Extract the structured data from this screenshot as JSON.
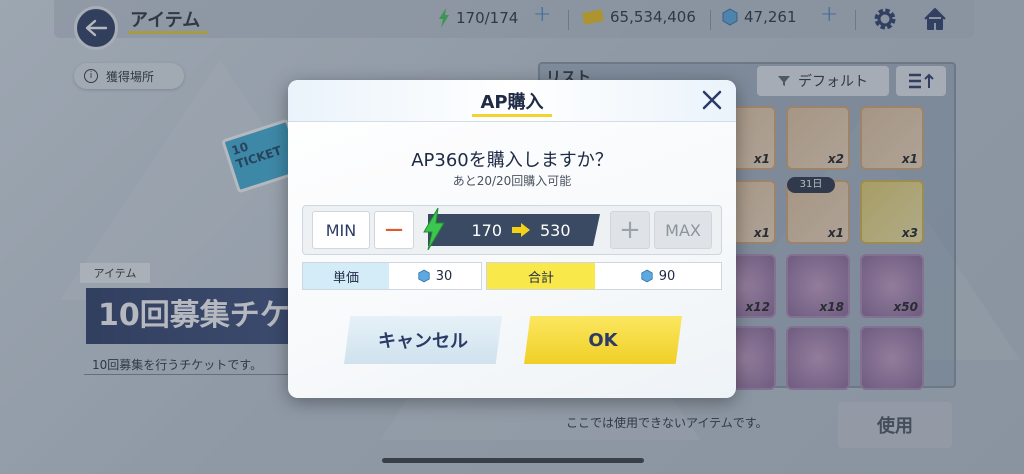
{
  "header": {
    "title": "アイテム",
    "ap": "170/174",
    "gold": "65,534,406",
    "gems": "47,261"
  },
  "left_panel": {
    "acquisition_label": "獲得場所",
    "category_tag": "アイテム",
    "item_name": "10回募集チケット",
    "item_description": "10回募集を行うチケットです。",
    "ticket_label": "10 TICKET"
  },
  "list_panel": {
    "title": "リスト",
    "sort_label": "デフォルト",
    "date_badge": "31日",
    "tiles": [
      {
        "count": "x1",
        "style": "normal"
      },
      {
        "count": "x2",
        "style": "normal"
      },
      {
        "count": "x1",
        "style": "normal"
      },
      {
        "count": "x1",
        "style": "normal"
      },
      {
        "count": "x1",
        "style": "normal"
      },
      {
        "count": "x3",
        "style": "yellow"
      },
      {
        "count": "x12",
        "style": "purple"
      },
      {
        "count": "x18",
        "style": "purple"
      },
      {
        "count": "x50",
        "style": "purple"
      },
      {
        "count": "",
        "style": "purple"
      },
      {
        "count": "",
        "style": "purple"
      },
      {
        "count": "",
        "style": "purple"
      }
    ]
  },
  "footer": {
    "note": "ここでは使用できないアイテムです。",
    "use_label": "使用"
  },
  "modal": {
    "title": "AP購入",
    "question": "AP360を購入しますか？",
    "remaining": "あと20/20回購入可能",
    "min_label": "MIN",
    "max_label": "MAX",
    "minus_symbol": "−",
    "plus_symbol": "+",
    "ap_from": "170",
    "ap_to": "530",
    "unit_price_label": "単価",
    "unit_price_value": "30",
    "total_label": "合計",
    "total_value": "90",
    "cancel_label": "キャンセル",
    "ok_label": "OK"
  },
  "colors": {
    "accent_yellow": "#f2d330",
    "navy": "#2c3b66",
    "minus_orange": "#e05a2a"
  }
}
